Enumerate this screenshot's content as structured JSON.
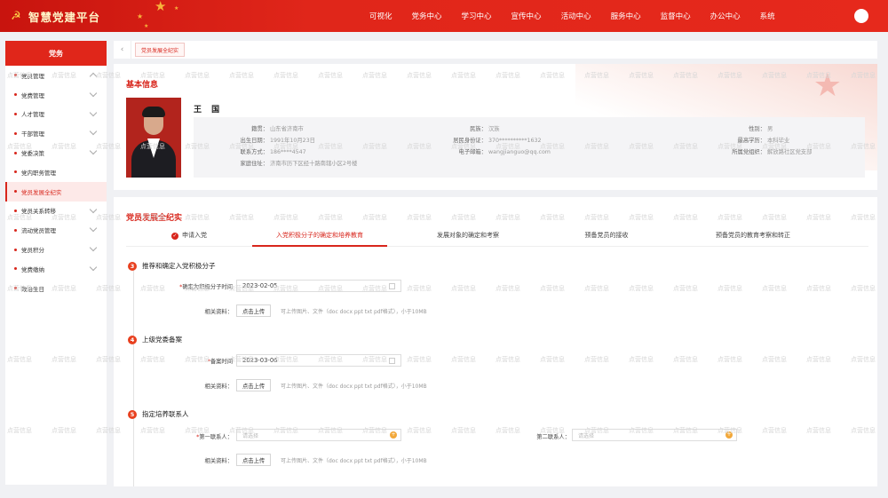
{
  "app": {
    "title": "智慧党建平台",
    "emblem": "☭"
  },
  "topnav": [
    "可视化",
    "党务中心",
    "学习中心",
    "宣传中心",
    "活动中心",
    "服务中心",
    "监督中心",
    "办公中心",
    "系统"
  ],
  "sidebar": {
    "header": "党务",
    "items": [
      {
        "label": "党员管理"
      },
      {
        "label": "党费管理"
      },
      {
        "label": "人才管理"
      },
      {
        "label": "干部管理"
      },
      {
        "label": "党委决策"
      },
      {
        "label": "党内职务管理"
      },
      {
        "label": "党员发展全纪实"
      },
      {
        "label": "党员关系转移"
      },
      {
        "label": "流动党员管理"
      },
      {
        "label": "党员积分"
      },
      {
        "label": "党费缴纳"
      },
      {
        "label": "政治生日"
      }
    ]
  },
  "tabs": {
    "back_icon": "‹",
    "active": "党员发展全纪实"
  },
  "basic": {
    "title": "基本信息",
    "name": "王 国",
    "fields": {
      "native_label": "籍贯：",
      "native": "山东省济南市",
      "ethnic_label": "民族：",
      "ethnic": "汉族",
      "gender_label": "性别：",
      "gender": "男",
      "birth_label": "出生日期：",
      "birth": "1991年10月23日",
      "id_label": "居民身份证：",
      "id": "370**********1632",
      "edu_label": "最高学历：",
      "edu": "本科毕业",
      "phone_label": "联系方式：",
      "phone": "186****4547",
      "email_label": "电子邮箱：",
      "email": "wangjianguo@qq.com",
      "org_label": "所属党组织：",
      "org": "解放路社区党支部",
      "addr_label": "家庭住址：",
      "addr": "济南市历下区经十路南辖小区2号楼"
    }
  },
  "dev": {
    "title": "党员发展全纪实",
    "steps": [
      "申请入党",
      "入党积极分子的确定和培养教育",
      "发展对象的确定和考察",
      "预备党员的接收",
      "预备党员的教育考察和转正"
    ],
    "check_mark": "✓",
    "sections": [
      {
        "num": "3",
        "title": "推荐和确定入党积极分子",
        "field_label": "确定为积极分子时间",
        "field_value": "2023-02-05",
        "upload_label": "相关资料：",
        "upload_btn": "点击上传",
        "hint": "可上传图片、文件（doc docx ppt txt pdf格式），小于10MB"
      },
      {
        "num": "4",
        "title": "上级党委备案",
        "field_label": "备案时间",
        "field_value": "2023-03-06",
        "upload_label": "相关资料：",
        "upload_btn": "点击上传",
        "hint": "可上传图片、文件（doc docx ppt txt pdf格式），小于10MB"
      },
      {
        "num": "5",
        "title": "指定培养联系人",
        "field_label": "第一联系人：",
        "field_placeholder": "请选择",
        "field2_label": "第二联系人：",
        "field2_placeholder": "请选择",
        "upload_label": "相关资料：",
        "upload_btn": "点击上传",
        "hint": "可上传图片、文件（doc docx ppt txt pdf格式），小于10MB"
      }
    ]
  },
  "watermark": "点营信息",
  "colors": {
    "brand": "#e0261a",
    "accent": "#d8261c"
  }
}
